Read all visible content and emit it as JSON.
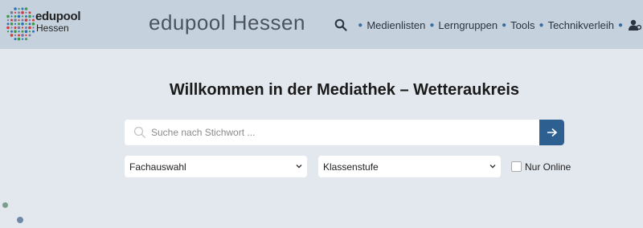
{
  "header": {
    "logo": {
      "line1": "edupool",
      "line2": "Hessen"
    },
    "title": "edupool Hessen",
    "nav": [
      {
        "label": "Medienlisten"
      },
      {
        "label": "Lerngruppen"
      },
      {
        "label": "Tools"
      },
      {
        "label": "Technikverleih"
      }
    ]
  },
  "main": {
    "headline": "Willkommen in der Mediathek – Wetteraukreis",
    "search": {
      "placeholder": "Suche nach Stichwort ...",
      "value": ""
    },
    "filters": {
      "subject_select": "Fachauswahl",
      "grade_select": "Klassenstufe",
      "online_label": "Nur Online",
      "online_checked": false
    }
  },
  "colors": {
    "header_bg": "#c5d1dc",
    "page_bg": "#e3e8ee",
    "accent": "#2e5f91"
  },
  "icons": [
    "search-icon",
    "user-settings-icon",
    "arrow-right-icon",
    "chevron-down-icon"
  ]
}
